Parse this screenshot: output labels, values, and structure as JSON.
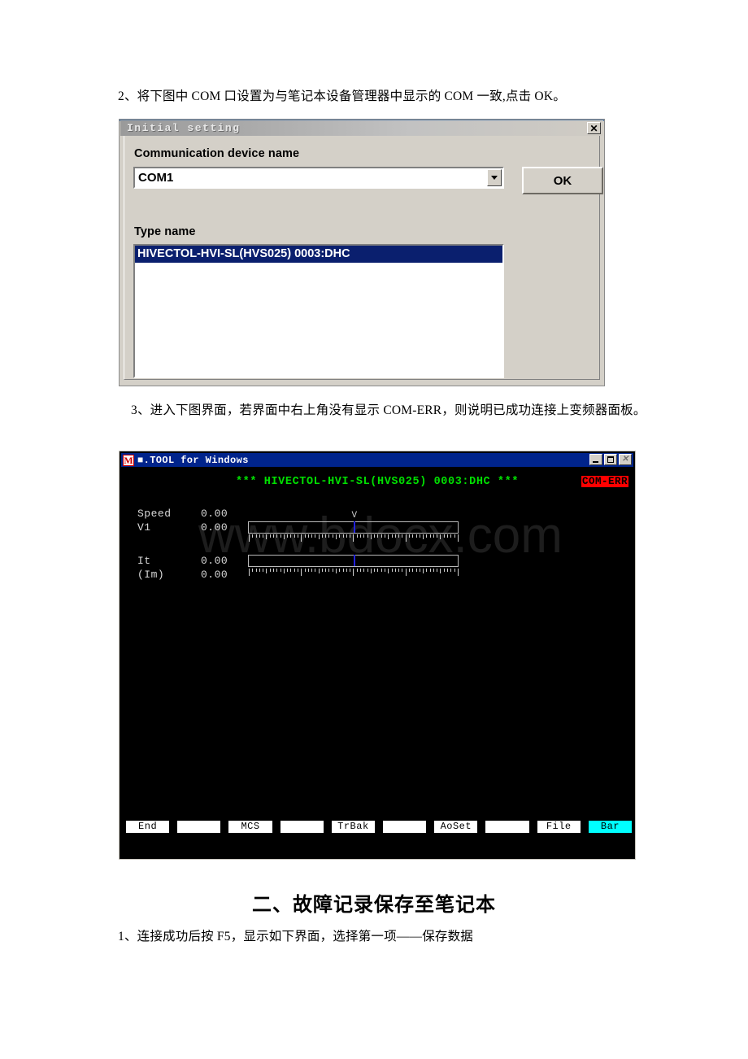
{
  "document": {
    "step2_text": "2、将下图中 COM 口设置为与笔记本设备管理器中显示的 COM 一致,点击 OK。",
    "step3_text": "3、进入下图界面，若界面中右上角没有显示 COM-ERR，则说明已成功连接上变频器面板。",
    "section_heading": "二、故障记录保存至笔记本",
    "step1b_text": "1、连接成功后按 F5，显示如下界面，选择第一项——保存数据"
  },
  "initial_setting_dialog": {
    "title": "Initial setting",
    "close_label": "✕",
    "comm_device_label": "Communication device name",
    "comm_device_value": "COM1",
    "comm_device_options": [
      "COM1"
    ],
    "ok_label": "OK",
    "type_name_label": "Type name",
    "type_list": [
      {
        "label": "HIVECTOL-HVI-SL(HVS025) 0003:DHC",
        "selected": true
      }
    ],
    "colors": {
      "face": "#d4d0c8",
      "selection": "#0a1f6e"
    }
  },
  "console_window": {
    "title": "■.TOOL for Windows",
    "app_icon_letter": "M",
    "window_buttons": {
      "minimize": "minimize-button",
      "maximize": "maximize-button",
      "close": "close-button"
    },
    "header_line": "*** HIVECTOL-HVI-SL(HVS025) 0003:DHC ***",
    "status_badge": "COM-ERR",
    "watermark": "www.bdocx.com",
    "gauges": [
      {
        "rows": [
          {
            "name": "Speed",
            "value": "0.00"
          },
          {
            "name": "V1",
            "value": "0.00"
          }
        ],
        "marker_label": "V",
        "marker_position_pct": 50
      },
      {
        "rows": [
          {
            "name": "It",
            "value": "0.00"
          },
          {
            "name": "(Im)",
            "value": "0.00"
          }
        ],
        "marker_label": "",
        "marker_position_pct": 50
      }
    ],
    "function_keys": [
      {
        "label": "End",
        "active": false
      },
      {
        "label": "",
        "active": false
      },
      {
        "label": "MCS",
        "active": false
      },
      {
        "label": "",
        "active": false
      },
      {
        "label": "TrBak",
        "active": false
      },
      {
        "label": "",
        "active": false
      },
      {
        "label": "AoSet",
        "active": false
      },
      {
        "label": "",
        "active": false
      },
      {
        "label": "File",
        "active": false
      },
      {
        "label": "Bar",
        "active": true
      }
    ],
    "colors": {
      "titlebar": "#00248c",
      "header_text": "#00e000",
      "status_badge_bg": "#ff0000",
      "active_key_bg": "#00ffff",
      "marker": "#2222dd"
    }
  }
}
